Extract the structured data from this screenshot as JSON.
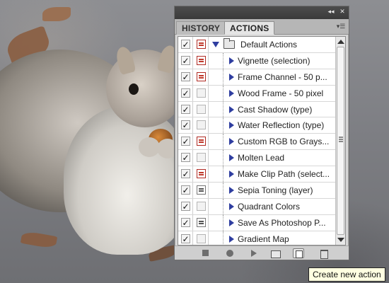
{
  "panel": {
    "tabs": [
      {
        "label": "HISTORY"
      },
      {
        "label": "ACTIONS"
      }
    ],
    "set": {
      "label": "Default Actions",
      "checked": true,
      "dialog": "red"
    },
    "actions": [
      {
        "label": "Vignette (selection)",
        "dialog": "red"
      },
      {
        "label": "Frame Channel - 50 p...",
        "dialog": "red"
      },
      {
        "label": "Wood Frame - 50 pixel",
        "dialog": "none"
      },
      {
        "label": "Cast Shadow (type)",
        "dialog": "none"
      },
      {
        "label": "Water Reflection (type)",
        "dialog": "none"
      },
      {
        "label": "Custom RGB to Grays...",
        "dialog": "red"
      },
      {
        "label": "Molten Lead",
        "dialog": "none"
      },
      {
        "label": "Make Clip Path (select...",
        "dialog": "red"
      },
      {
        "label": "Sepia Toning (layer)",
        "dialog": "gray"
      },
      {
        "label": "Quadrant Colors",
        "dialog": "none"
      },
      {
        "label": "Save As Photoshop P...",
        "dialog": "gray"
      },
      {
        "label": "Gradient Map",
        "dialog": "none"
      }
    ],
    "toolbar_icons": [
      "stop-icon",
      "record-icon",
      "play-selection-icon",
      "new-set-icon",
      "new-action-icon",
      "trash-icon"
    ]
  },
  "tooltip": {
    "text": "Create new action"
  },
  "colors": {
    "accent_blue": "#2f3ea0",
    "dialog_red": "#c0392b",
    "panel_bg": "#d6d6d6"
  }
}
